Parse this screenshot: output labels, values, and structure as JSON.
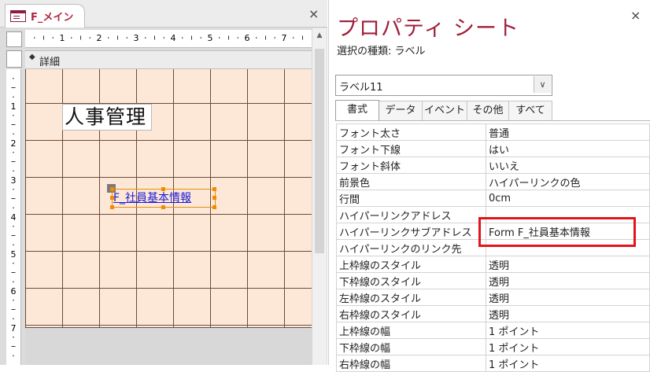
{
  "left_pane": {
    "tab_title": "F_メイン",
    "close_glyph": "×",
    "ruler_h_numbers": [
      "1",
      "2",
      "3",
      "4",
      "5",
      "6",
      "7"
    ],
    "ruler_v_numbers": [
      "1",
      "2",
      "3",
      "4",
      "5",
      "6",
      "7"
    ],
    "section_label": "詳細",
    "title_label": "人事管理",
    "selected_label_text": "F_社員基本情報"
  },
  "property_sheet": {
    "title": "プロパティ シート",
    "selection_type": "選択の種類: ラベル",
    "object_select": "ラベル11",
    "close_glyph": "×",
    "tabs": [
      "書式",
      "データ",
      "イベント",
      "その他",
      "すべて"
    ],
    "active_tab": "書式",
    "rows": [
      {
        "name": "フォント太さ",
        "value": "普通"
      },
      {
        "name": "フォント下線",
        "value": "はい"
      },
      {
        "name": "フォント斜体",
        "value": "いいえ"
      },
      {
        "name": "前景色",
        "value": "ハイパーリンクの色"
      },
      {
        "name": "行間",
        "value": "0cm"
      },
      {
        "name": "ハイパーリンクアドレス",
        "value": ""
      },
      {
        "name": "ハイパーリンクサブアドレス",
        "value": "Form F_社員基本情報"
      },
      {
        "name": "ハイパーリンクのリンク先",
        "value": ""
      },
      {
        "name": "上枠線のスタイル",
        "value": "透明"
      },
      {
        "name": "下枠線のスタイル",
        "value": "透明"
      },
      {
        "name": "左枠線のスタイル",
        "value": "透明"
      },
      {
        "name": "右枠線のスタイル",
        "value": "透明"
      },
      {
        "name": "上枠線の幅",
        "value": "1 ポイント"
      },
      {
        "name": "下枠線の幅",
        "value": "1 ポイント"
      },
      {
        "name": "右枠線の幅",
        "value": "1 ポイント"
      }
    ]
  },
  "colors": {
    "accent": "#a11f3a",
    "grid_background": "#fde8d8",
    "selection_handle": "#f08c00",
    "highlight_box": "#e0161c",
    "hyperlink": "#1a1ad8"
  }
}
